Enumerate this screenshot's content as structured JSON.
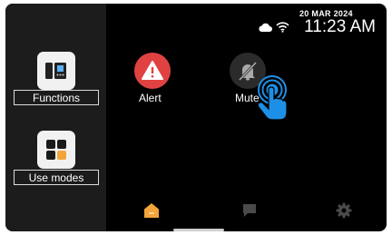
{
  "status": {
    "date": "20 MAR 2024",
    "time": "11:23 AM"
  },
  "sidebar": {
    "items": [
      {
        "label": "Functions",
        "icon": "functions-icon"
      },
      {
        "label": "Use modes",
        "icon": "use-modes-icon"
      }
    ]
  },
  "apps": [
    {
      "label": "Alert",
      "icon": "alert-icon",
      "color": "#e04242"
    },
    {
      "label": "Mute",
      "icon": "mute-icon",
      "color": "#2b2b2b"
    }
  ],
  "nav": {
    "items": [
      {
        "icon": "home-icon",
        "active": true,
        "color": "#f2a53a"
      },
      {
        "icon": "chat-icon",
        "active": false,
        "color": "#4a4a4a"
      },
      {
        "icon": "settings-icon",
        "active": false,
        "color": "#4a4a4a"
      }
    ]
  },
  "gesture": {
    "icon": "tap-hand-icon",
    "color": "#1e8fe6"
  }
}
